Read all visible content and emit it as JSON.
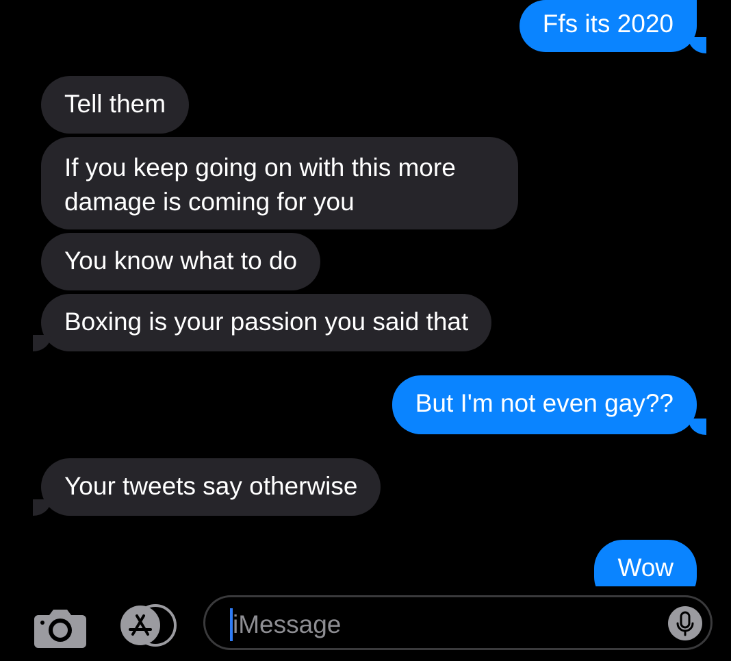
{
  "conversation": {
    "messages": [
      {
        "direction": "outgoing",
        "text": "Ffs its 2020"
      },
      {
        "direction": "incoming",
        "text": "Tell them"
      },
      {
        "direction": "incoming",
        "text": "If you keep going on with this more damage is coming for you"
      },
      {
        "direction": "incoming",
        "text": "You know what to do"
      },
      {
        "direction": "incoming",
        "text": "Boxing is your passion you said that"
      },
      {
        "direction": "outgoing",
        "text": "But I'm not even gay??"
      },
      {
        "direction": "incoming",
        "text": "Your tweets say otherwise"
      },
      {
        "direction": "outgoing",
        "text": "Wow"
      }
    ]
  },
  "input_bar": {
    "camera_icon": "camera-icon",
    "apps_icon": "app-store-icon",
    "message_placeholder": "iMessage",
    "mic_icon": "microphone-icon"
  },
  "colors": {
    "background": "#000000",
    "outgoing_bubble": "#0a84ff",
    "incoming_bubble": "#26252a",
    "placeholder_text": "#8e8e93",
    "icon_gray": "#9b9ba0"
  }
}
